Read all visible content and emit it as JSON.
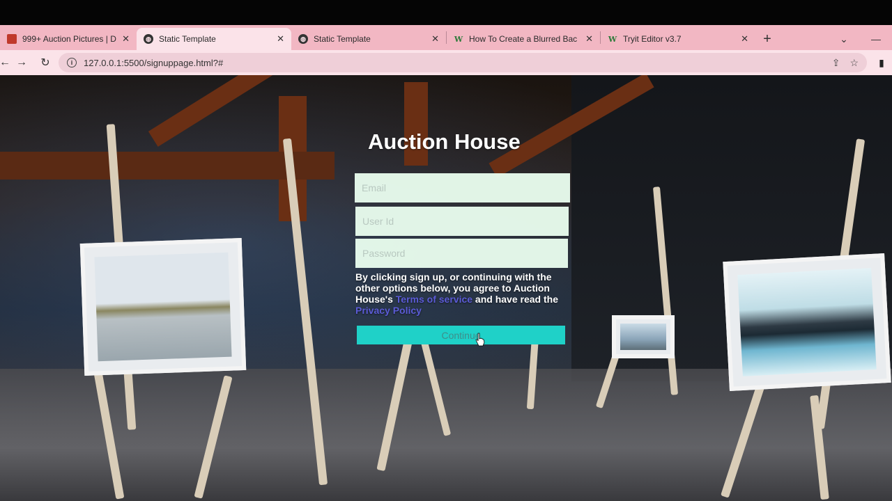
{
  "browser": {
    "tabs": [
      {
        "title": "999+ Auction Pictures | Dow",
        "icon": "image-icon",
        "active": false
      },
      {
        "title": "Static Template",
        "icon": "globe-icon",
        "active": true
      },
      {
        "title": "Static Template",
        "icon": "globe-icon",
        "active": false
      },
      {
        "title": "How To Create a Blurred Bac",
        "icon": "w3-icon",
        "active": false
      },
      {
        "title": "Tryit Editor v3.7",
        "icon": "w3-icon",
        "active": false
      }
    ],
    "new_tab_label": "+",
    "url": "127.0.0.1:5500/signuppage.html?#",
    "accent_color": "#f2b7c3"
  },
  "page": {
    "title": "Auction House",
    "email_placeholder": "Email",
    "userid_placeholder": "User Id",
    "password_placeholder": "Password",
    "terms_prefix": "By clicking sign up, or continuing with the other options below, you agree to Auction House's ",
    "terms_link": "Terms of service",
    "terms_middle": " and have read the ",
    "privacy_link": "Privacy Policy",
    "continue_label": "Continue",
    "button_color": "#1fd1c8"
  }
}
